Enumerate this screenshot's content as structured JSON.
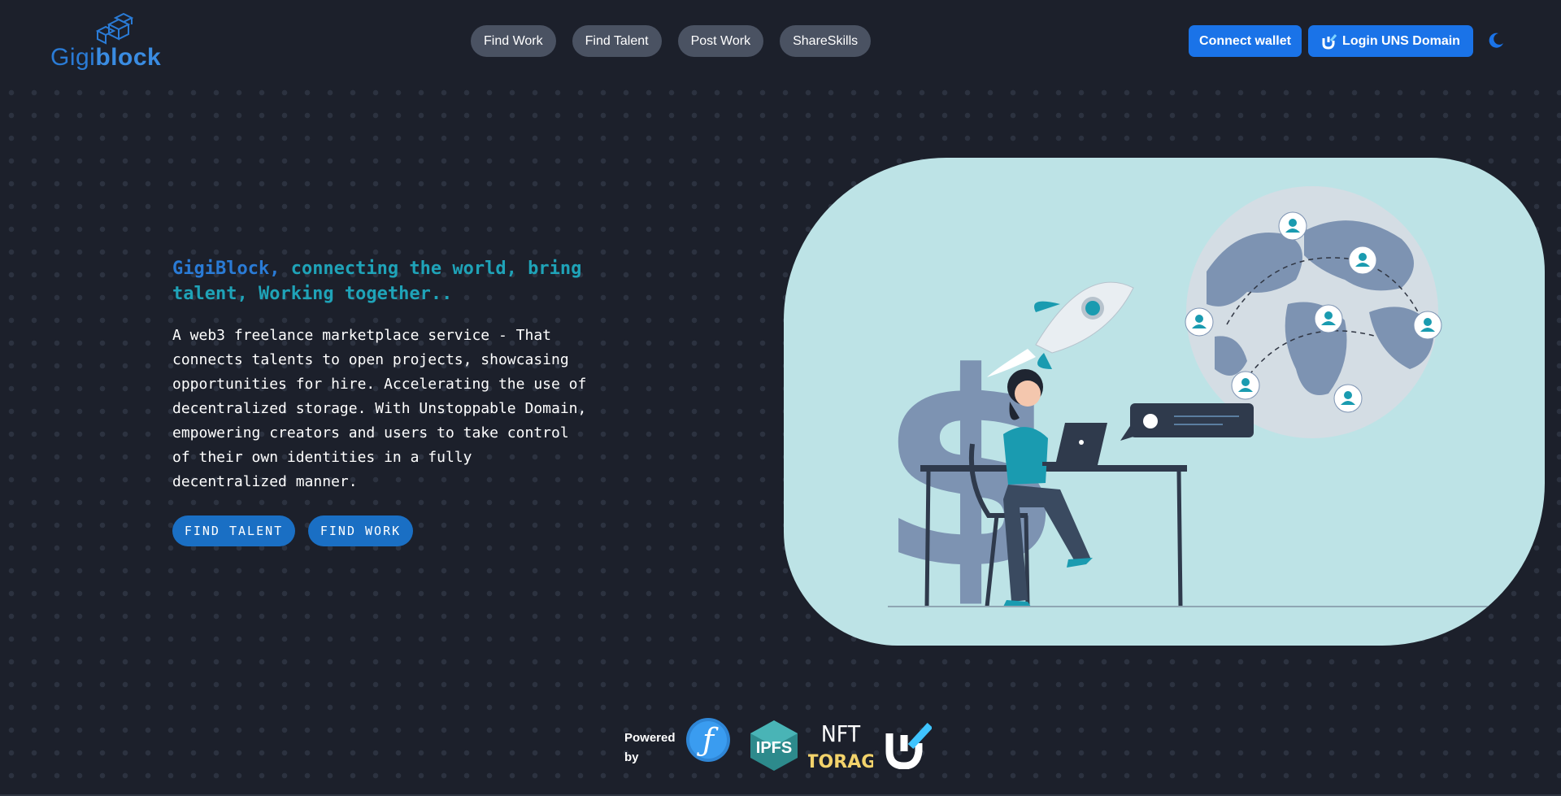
{
  "header": {
    "logo": {
      "part1": "Gigi",
      "part2": "block",
      "icon": "cubes-logo-icon"
    },
    "nav": [
      {
        "label": "Find Work"
      },
      {
        "label": "Find Talent"
      },
      {
        "label": "Post Work"
      },
      {
        "label": "ShareSkills"
      }
    ],
    "connect_wallet_label": "Connect wallet",
    "login_label": "Login UNS Domain",
    "theme_icon": "moon-icon"
  },
  "hero": {
    "tagline_brand": "GigiBlock,",
    "tagline_rest": " connecting the world, bring talent, Working together..",
    "description": "A web3 freelance marketplace service - That connects talents to open projects, showcasing opportunities for hire. Accelerating the use of decentralized storage. With Unstoppable Domain, empowering creators and users to take control of their own identities in a fully decentralized manner.",
    "cta_talent": "FIND TALENT",
    "cta_work": "FIND WORK"
  },
  "footer": {
    "powered_line1": "Powered",
    "powered_line2": "by",
    "logos": [
      "filecoin-logo",
      "ipfs-logo",
      "nft-storage-logo",
      "unstoppable-domains-logo"
    ],
    "ipfs_text": "IPFS",
    "nft_text_1": "NFT",
    "nft_text_2": "STORAGE"
  },
  "colors": {
    "background": "#1c202b",
    "accent_blue": "#1a73e8",
    "teal": "#1fa3b8",
    "nav_pill": "#4a5262",
    "illustration_bg": "#bde3e6"
  }
}
